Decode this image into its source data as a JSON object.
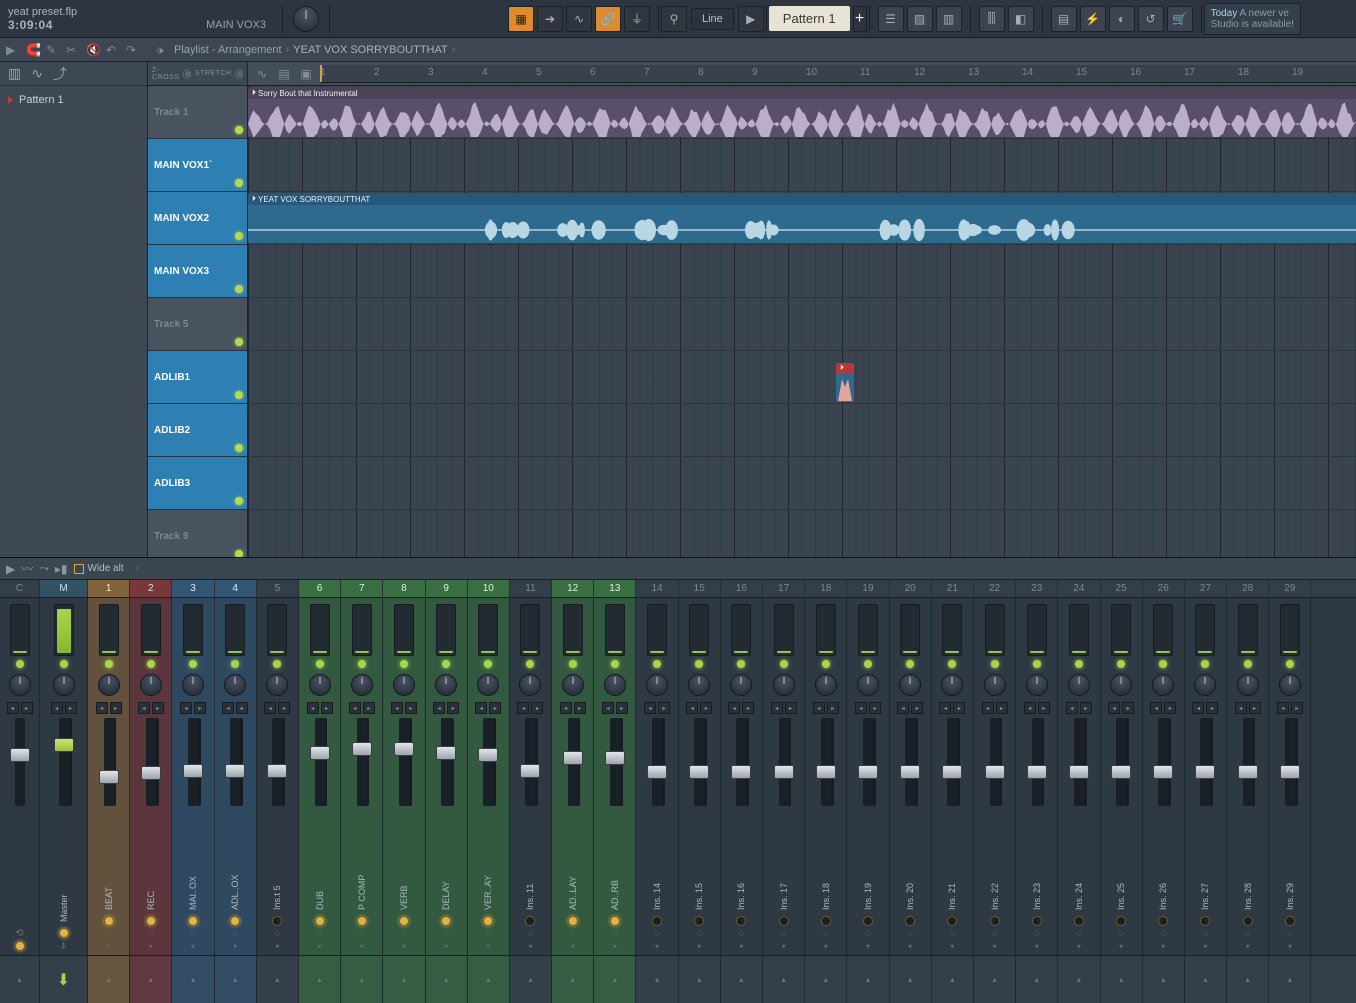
{
  "titlebar": {
    "file_name": "yeat preset.flp",
    "time": "3:09:04",
    "channel_label": "MAIN VOX3"
  },
  "hint_panel": {
    "today": "Today",
    "line1": "A newer ve",
    "line2": "Studio is available!"
  },
  "toolbar": {
    "snap_mode": "Line",
    "pattern_name": "Pattern 1"
  },
  "playlist": {
    "window_title": "Playlist - Arrangement",
    "breadcrumb": "YEAT VOX SORRYBOUTTHAT",
    "zcross": "Z-CROSS",
    "stretch": "STRETCH",
    "ruler_bars": [
      "1",
      "2",
      "3",
      "4",
      "5",
      "6",
      "7",
      "8",
      "9",
      "10",
      "11",
      "12",
      "13",
      "14",
      "15",
      "16",
      "17",
      "18",
      "19"
    ],
    "tracks": [
      {
        "name": "Track 1",
        "active": false
      },
      {
        "name": "MAIN VOX1`",
        "active": true
      },
      {
        "name": "MAIN VOX2",
        "active": true
      },
      {
        "name": "MAIN VOX3",
        "active": true
      },
      {
        "name": "Track 5",
        "active": false
      },
      {
        "name": "ADLIB1",
        "active": true
      },
      {
        "name": "ADLIB2",
        "active": true
      },
      {
        "name": "ADLIB3",
        "active": true
      },
      {
        "name": "Track 9",
        "active": false
      }
    ],
    "clips": {
      "instrumental": "Sorry Bout that Instrumental",
      "vox": "YEAT VOX SORRYBOUTTHAT"
    }
  },
  "sidebar": {
    "pattern": "Pattern 1"
  },
  "mixer": {
    "layout_name": "Wide alt",
    "labels": {
      "c": "C",
      "m": "M",
      "master": "Master"
    },
    "strips": [
      {
        "n": "1",
        "name": "BEAT",
        "color": "orange",
        "fader": 0.3,
        "send": true
      },
      {
        "n": "2",
        "name": "REC",
        "color": "red",
        "fader": 0.35,
        "send": true
      },
      {
        "n": "3",
        "name": "MAI..OX",
        "color": "blue",
        "fader": 0.38,
        "send": true
      },
      {
        "n": "4",
        "name": "ADL..OX",
        "color": "blue",
        "fader": 0.38,
        "send": true
      },
      {
        "n": "5",
        "name": "Ins.t 5",
        "color": "",
        "fader": 0.38,
        "send": false
      },
      {
        "n": "6",
        "name": "DUB",
        "color": "green",
        "fader": 0.62,
        "send": true
      },
      {
        "n": "7",
        "name": "P COMP",
        "color": "green",
        "fader": 0.68,
        "send": true
      },
      {
        "n": "8",
        "name": "VERB",
        "color": "green",
        "fader": 0.68,
        "send": true
      },
      {
        "n": "9",
        "name": "DELAY",
        "color": "green",
        "fader": 0.62,
        "send": true
      },
      {
        "n": "10",
        "name": "VER..AY",
        "color": "green",
        "fader": 0.6,
        "send": true
      },
      {
        "n": "11",
        "name": "Ins. 11",
        "color": "",
        "fader": 0.38,
        "send": false
      },
      {
        "n": "12",
        "name": "AD..LAY",
        "color": "green",
        "fader": 0.55,
        "send": true
      },
      {
        "n": "13",
        "name": "AD..RB",
        "color": "green",
        "fader": 0.55,
        "send": true
      },
      {
        "n": "14",
        "name": "Ins. 14",
        "color": "",
        "fader": 0.36,
        "send": false
      },
      {
        "n": "15",
        "name": "Ins. 15",
        "color": "",
        "fader": 0.36,
        "send": false
      },
      {
        "n": "16",
        "name": "Ins. 16",
        "color": "",
        "fader": 0.36,
        "send": false
      },
      {
        "n": "17",
        "name": "Ins. 17",
        "color": "",
        "fader": 0.36,
        "send": false
      },
      {
        "n": "18",
        "name": "Ins. 18",
        "color": "",
        "fader": 0.36,
        "send": false
      },
      {
        "n": "19",
        "name": "Ins. 19",
        "color": "",
        "fader": 0.36,
        "send": false
      },
      {
        "n": "20",
        "name": "Ins. 20",
        "color": "",
        "fader": 0.36,
        "send": false
      },
      {
        "n": "21",
        "name": "Ins. 21",
        "color": "",
        "fader": 0.36,
        "send": false
      },
      {
        "n": "22",
        "name": "Ins. 22",
        "color": "",
        "fader": 0.36,
        "send": false
      },
      {
        "n": "23",
        "name": "Ins. 23",
        "color": "",
        "fader": 0.36,
        "send": false
      },
      {
        "n": "24",
        "name": "Ins. 24",
        "color": "",
        "fader": 0.36,
        "send": false
      },
      {
        "n": "25",
        "name": "Ins. 25",
        "color": "",
        "fader": 0.36,
        "send": false
      },
      {
        "n": "26",
        "name": "Ins. 26",
        "color": "",
        "fader": 0.36,
        "send": false
      },
      {
        "n": "27",
        "name": "Ins. 27",
        "color": "",
        "fader": 0.36,
        "send": false
      },
      {
        "n": "28",
        "name": "Ins. 28",
        "color": "",
        "fader": 0.36,
        "send": false
      },
      {
        "n": "29",
        "name": "Ins. 29",
        "color": "",
        "fader": 0.36,
        "send": false
      }
    ]
  }
}
